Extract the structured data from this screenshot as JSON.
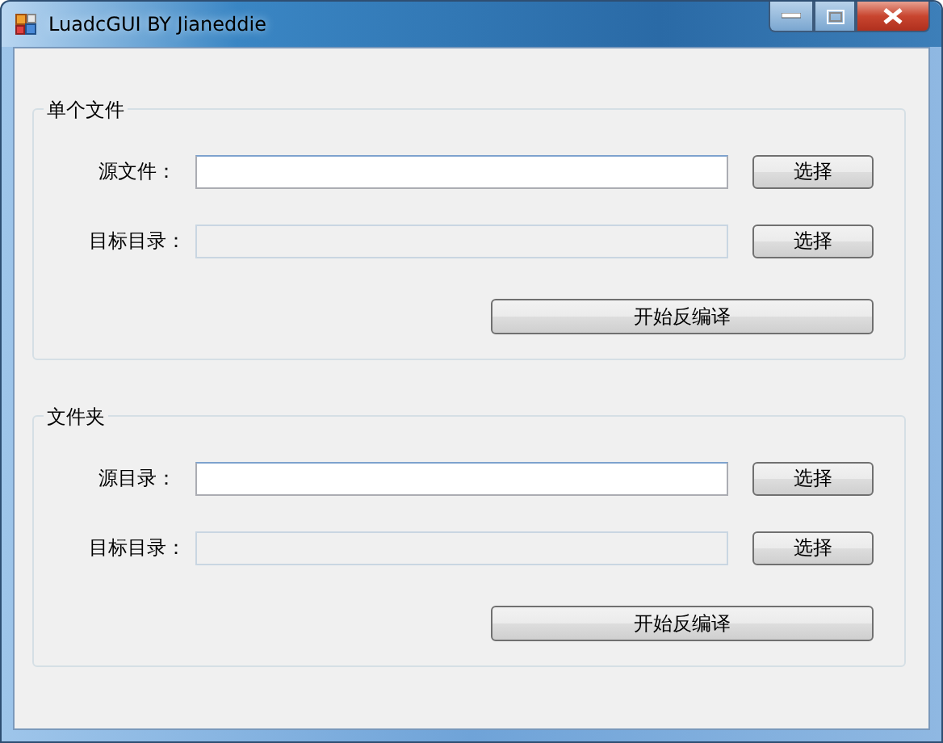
{
  "window": {
    "title": "LuadcGUI BY Jianeddie"
  },
  "groups": [
    {
      "title": "单个文件",
      "rows": [
        {
          "label": "源文件：",
          "readonly": false,
          "button": "选择"
        },
        {
          "label": "目标目录：",
          "readonly": true,
          "button": "选择"
        }
      ],
      "action": "开始反编译"
    },
    {
      "title": "文件夹",
      "rows": [
        {
          "label": "源目录：",
          "readonly": false,
          "button": "选择"
        },
        {
          "label": "目标目录：",
          "readonly": true,
          "button": "选择"
        }
      ],
      "action": "开始反编译"
    }
  ]
}
